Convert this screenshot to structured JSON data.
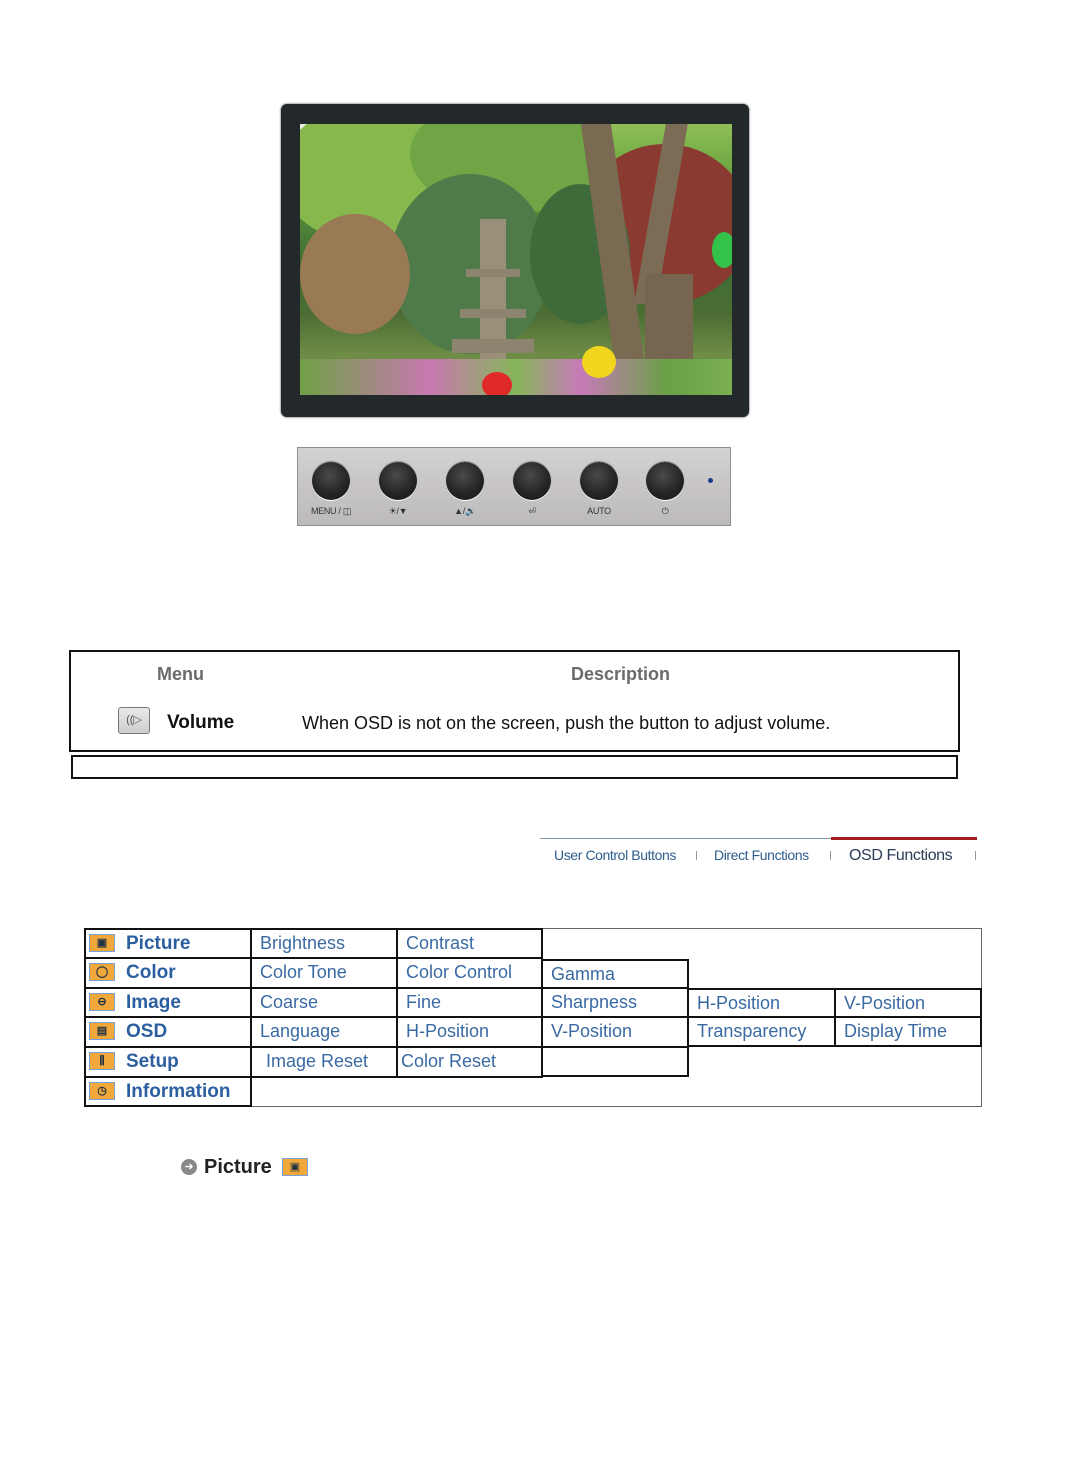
{
  "monitor": {
    "image_alt": "Monitor displaying garden with stone pagoda and lanterns"
  },
  "control_panel": {
    "buttons": [
      {
        "label": "MENU / ◫",
        "icon": "menu-icon"
      },
      {
        "label": "☀/▼",
        "icon": "brightness-down-icon"
      },
      {
        "label": "▲/🔊",
        "icon": "up-volume-icon"
      },
      {
        "label": "⏎",
        "icon": "enter-source-icon"
      },
      {
        "label": "AUTO",
        "icon": "auto-icon"
      },
      {
        "label": "⏻",
        "icon": "power-icon"
      }
    ],
    "led_color": "#1a3a8a"
  },
  "description_table": {
    "header_menu": "Menu",
    "header_description": "Description",
    "rows": [
      {
        "icon": "volume-icon",
        "icon_glyph": "((▷",
        "name": "Volume",
        "description": "When OSD is not on the screen, push the button to adjust volume."
      }
    ]
  },
  "tabs": [
    {
      "label": "User Control Buttons",
      "active": false
    },
    {
      "label": "Direct Functions",
      "active": false
    },
    {
      "label": "OSD Functions",
      "active": true
    }
  ],
  "osd_menu": [
    {
      "label": "Picture",
      "icon": "picture-icon",
      "glyph": "▣",
      "items": [
        "Brightness",
        "Contrast"
      ]
    },
    {
      "label": "Color",
      "icon": "color-icon",
      "glyph": "◯",
      "items": [
        "Color Tone",
        "Color Control",
        "Gamma"
      ]
    },
    {
      "label": "Image",
      "icon": "image-icon",
      "glyph": "⊖",
      "items": [
        "Coarse",
        "Fine",
        "Sharpness",
        "H-Position",
        "V-Position"
      ]
    },
    {
      "label": "OSD",
      "icon": "osd-icon",
      "glyph": "▤",
      "items": [
        "Language",
        "H-Position",
        "V-Position",
        "Transparency",
        "Display Time"
      ]
    },
    {
      "label": "Setup",
      "icon": "setup-icon",
      "glyph": "⫼",
      "items": [
        "Image Reset",
        "Color Reset",
        ""
      ]
    },
    {
      "label": "Information",
      "icon": "information-icon",
      "glyph": "◷",
      "items": []
    }
  ],
  "section": {
    "title": "Picture",
    "arrow_glyph": "➜",
    "icon_glyph": "▣"
  },
  "colors": {
    "link_blue": "#3a6aa3",
    "menu_blue": "#2c5fa0",
    "active_tab_underline": "#a41d22",
    "icon_orange": "#f0a83a"
  }
}
